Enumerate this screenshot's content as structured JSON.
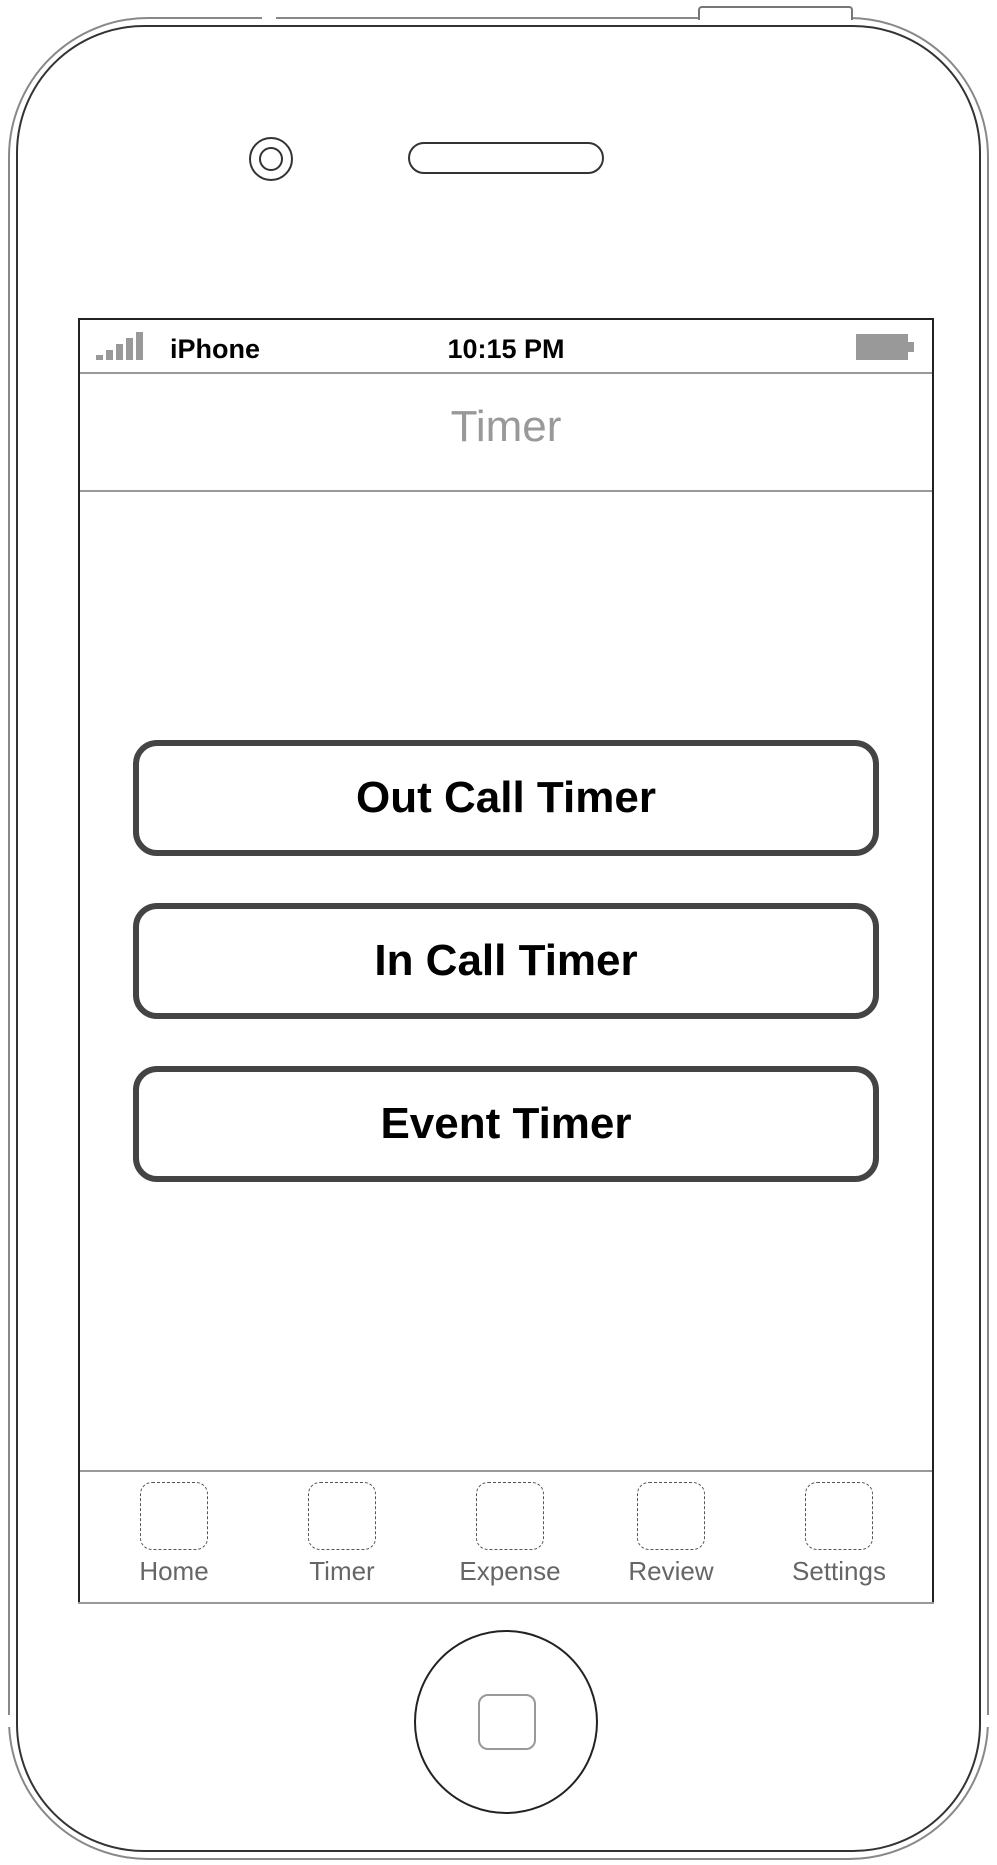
{
  "status_bar": {
    "carrier": "iPhone",
    "time": "10:15 PM"
  },
  "nav_bar": {
    "title": "Timer"
  },
  "buttons": [
    {
      "label": "Out Call Timer"
    },
    {
      "label": "In Call Timer"
    },
    {
      "label": "Event Timer"
    }
  ],
  "tab_bar": {
    "tabs": [
      {
        "label": "Home",
        "icon": "placeholder-icon"
      },
      {
        "label": "Timer",
        "icon": "placeholder-icon"
      },
      {
        "label": "Expense",
        "icon": "placeholder-icon"
      },
      {
        "label": "Review",
        "icon": "placeholder-icon"
      },
      {
        "label": "Settings",
        "icon": "placeholder-icon"
      }
    ]
  },
  "colors": {
    "button_border": "#444444",
    "title_gray": "#999999",
    "tab_label": "#666666"
  }
}
